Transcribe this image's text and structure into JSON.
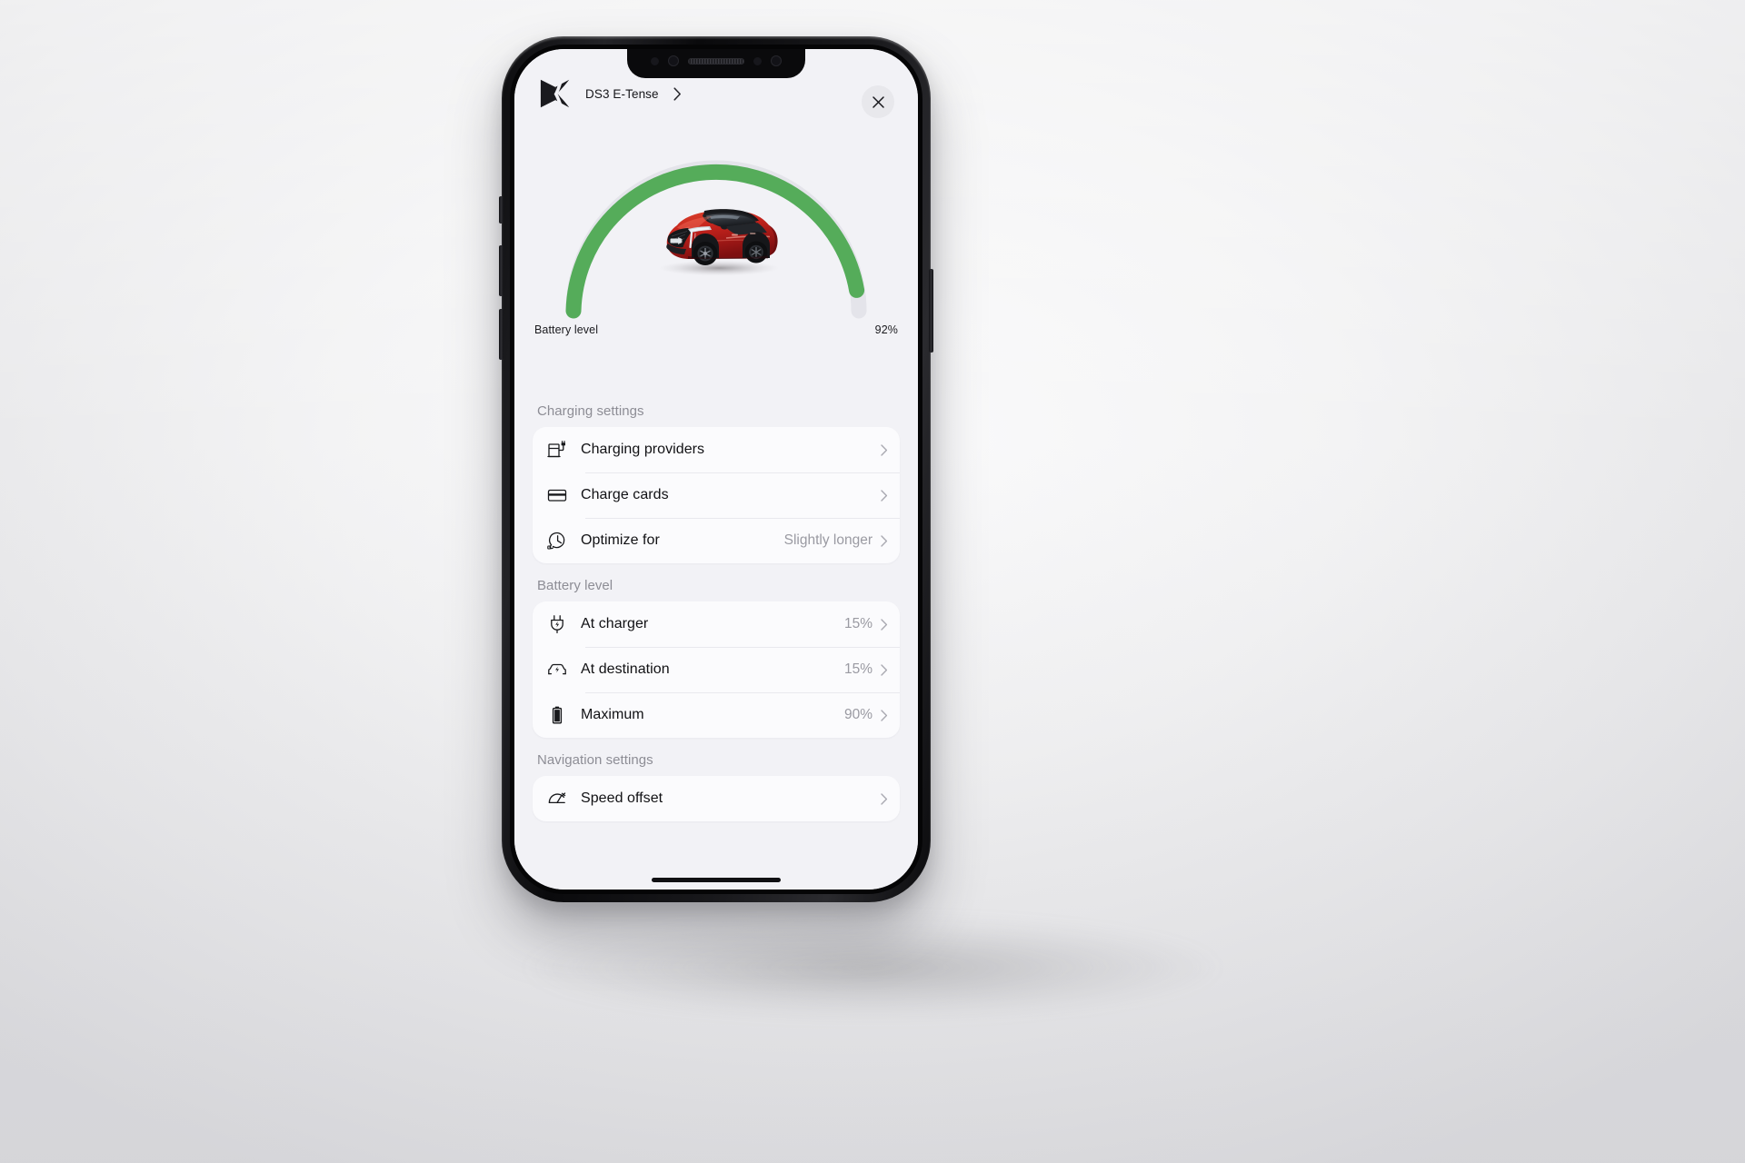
{
  "app": {
    "brand_logo": "ds-logo",
    "vehicle_name": "DS3 E-Tense",
    "close_label": "×"
  },
  "gauge": {
    "label": "Battery level",
    "value_text": "92%",
    "value": 92,
    "arc_color": "#55AC5A",
    "track_color": "#e3e3e8",
    "vehicle_image": "red-ds3-crossback-car"
  },
  "sections": [
    {
      "title": "Charging settings",
      "rows": [
        {
          "icon": "charging-station-icon",
          "label": "Charging providers",
          "value": "",
          "chevron": true
        },
        {
          "icon": "credit-card-icon",
          "label": "Charge cards",
          "value": "",
          "chevron": true
        },
        {
          "icon": "clock-plug-icon",
          "label": "Optimize for",
          "value": "Slightly longer",
          "chevron": true
        }
      ]
    },
    {
      "title": "Battery level",
      "rows": [
        {
          "icon": "plug-bolt-icon",
          "label": "At charger",
          "value": "15%",
          "chevron": true
        },
        {
          "icon": "car-bolt-icon",
          "label": "At destination",
          "value": "15%",
          "chevron": true
        },
        {
          "icon": "battery-icon",
          "label": "Maximum",
          "value": "90%",
          "chevron": true
        }
      ]
    },
    {
      "title": "Navigation settings",
      "rows": [
        {
          "icon": "speedometer-icon",
          "label": "Speed offset",
          "value": "",
          "chevron": true
        }
      ]
    }
  ],
  "colors": {
    "screen_bg": "#f2f2f6",
    "card_bg": "#fbfbfd",
    "accent_green": "#55AC5A",
    "text_primary": "#111114",
    "text_secondary": "#9a9aa2",
    "section_title": "#8d8d95"
  }
}
